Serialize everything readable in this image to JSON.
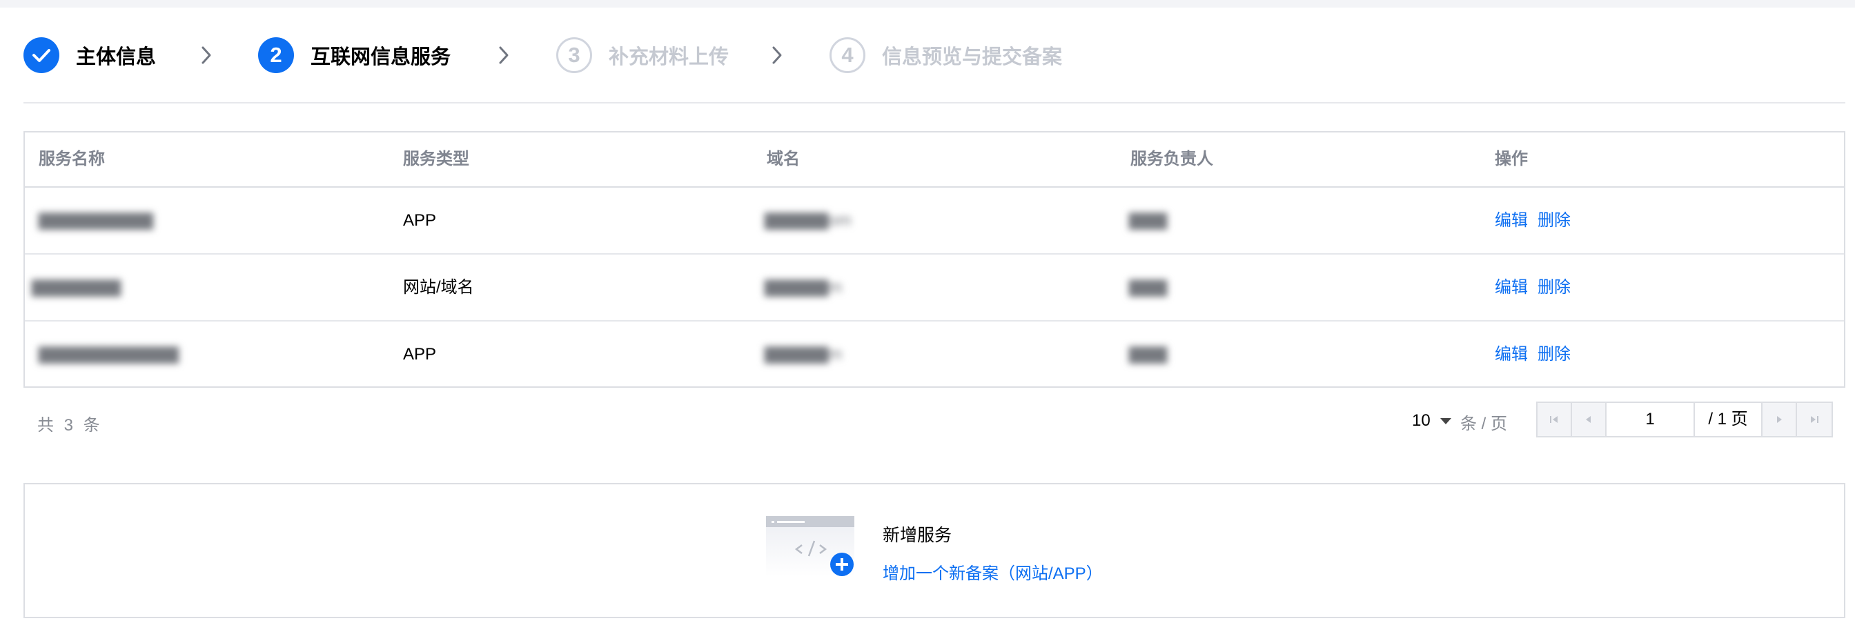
{
  "stepper": [
    {
      "index": "",
      "label": "主体信息",
      "state": "done"
    },
    {
      "index": "2",
      "label": "互联网信息服务",
      "state": "active"
    },
    {
      "index": "3",
      "label": "补充材料上传",
      "state": "todo"
    },
    {
      "index": "4",
      "label": "信息预览与提交备案",
      "state": "todo"
    }
  ],
  "table": {
    "columns": [
      "服务名称",
      "服务类型",
      "域名",
      "服务负责人",
      "操作"
    ],
    "rows": [
      {
        "name": "▇▇▇▇▇▇▇▇▇",
        "type": "APP",
        "domain": "▇▇▇▇▇om",
        "owner": "▇▇▇",
        "edit": "编辑",
        "delete": "删除"
      },
      {
        "name": "▇▇▇▇▇▇▇",
        "type": "网站/域名",
        "domain": "▇▇▇▇▇m",
        "owner": "▇▇▇",
        "edit": "编辑",
        "delete": "删除"
      },
      {
        "name": "▇▇▇▇▇▇▇▇▇▇▇",
        "type": "APP",
        "domain": "▇▇▇▇▇m",
        "owner": "▇▇▇",
        "edit": "编辑",
        "delete": "删除"
      }
    ]
  },
  "pagination": {
    "total": "共 3 条",
    "page_size": "10",
    "per_page_label": "条 / 页",
    "current_page": "1",
    "total_pages": "/ 1 页"
  },
  "add_service": {
    "title": "新增服务",
    "link": "增加一个新备案（网站/APP）"
  },
  "colors": {
    "accent": "#0d6ff2",
    "border": "#dcdee3",
    "muted_text": "#888c94",
    "disabled_step": "#c5c9d1"
  },
  "icons": {
    "step_done": "check-icon",
    "step_separator": "chevron-right-icon",
    "pager_first": "first-page-icon",
    "pager_prev": "prev-page-icon",
    "pager_next": "next-page-icon",
    "pager_last": "last-page-icon",
    "add": "add-circle-icon"
  }
}
